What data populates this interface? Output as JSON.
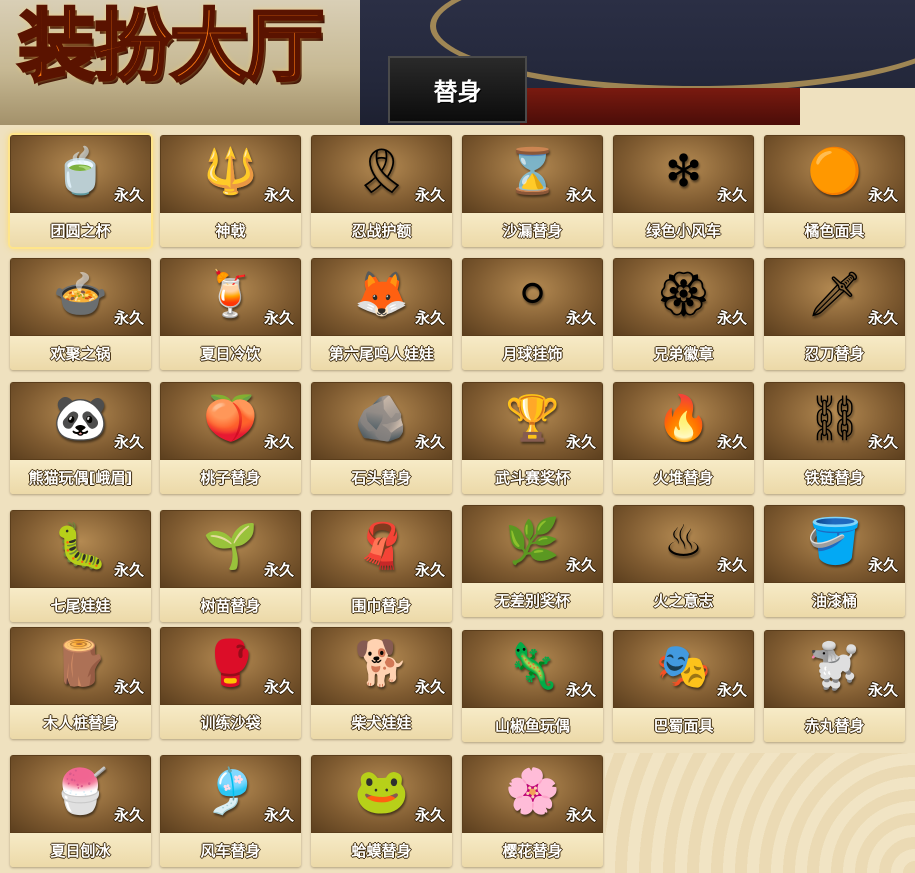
{
  "header": {
    "title": "装扮大厅",
    "tab_label": "替身"
  },
  "colors": {
    "title_orange": "#ff7a10",
    "card_brown": "#7e5a30",
    "label_cream": "#f0dfb4",
    "selected_glow": "#ffe58a"
  },
  "items": [
    {
      "name": "团圆之杯",
      "duration": "永久",
      "icon": "cup-icon",
      "glyph": "🍵",
      "selected": true
    },
    {
      "name": "神戟",
      "duration": "永久",
      "icon": "halberd-icon",
      "glyph": "🔱"
    },
    {
      "name": "忍战护额",
      "duration": "永久",
      "icon": "headband-icon",
      "glyph": "🎗"
    },
    {
      "name": "沙漏替身",
      "duration": "永久",
      "icon": "hourglass-icon",
      "glyph": "⌛"
    },
    {
      "name": "绿色小风车",
      "duration": "永久",
      "icon": "pinwheel-icon",
      "glyph": "❇"
    },
    {
      "name": "橘色面具",
      "duration": "永久",
      "icon": "mask-icon",
      "glyph": "🟠"
    },
    {
      "name": "欢聚之锅",
      "duration": "永久",
      "icon": "pot-icon",
      "glyph": "🍲"
    },
    {
      "name": "夏日冷饮",
      "duration": "永久",
      "icon": "cold-drink-icon",
      "glyph": "🍹"
    },
    {
      "name": "第六尾鸣人娃娃",
      "duration": "永久",
      "icon": "doll-icon",
      "glyph": "🦊"
    },
    {
      "name": "月球挂饰",
      "duration": "永久",
      "icon": "moon-charm-icon",
      "glyph": "⚪"
    },
    {
      "name": "兄弟徽章",
      "duration": "永久",
      "icon": "badge-icon",
      "glyph": "🏵"
    },
    {
      "name": "忍刀替身",
      "duration": "永久",
      "icon": "ninja-sword-icon",
      "glyph": "🗡"
    },
    {
      "name": "熊猫玩偶[峨眉]",
      "duration": "永久",
      "icon": "panda-icon",
      "glyph": "🐼"
    },
    {
      "name": "桃子替身",
      "duration": "永久",
      "icon": "peach-icon",
      "glyph": "🍑"
    },
    {
      "name": "石头替身",
      "duration": "永久",
      "icon": "stone-icon",
      "glyph": "🪨"
    },
    {
      "name": "武斗赛奖杯",
      "duration": "永久",
      "icon": "trophy-icon",
      "glyph": "🏆"
    },
    {
      "name": "火堆替身",
      "duration": "永久",
      "icon": "campfire-icon",
      "glyph": "🔥"
    },
    {
      "name": "铁链替身",
      "duration": "永久",
      "icon": "chain-icon",
      "glyph": "⛓"
    },
    {
      "name": "七尾娃娃",
      "duration": "永久",
      "icon": "larva-doll-icon",
      "glyph": "🐛"
    },
    {
      "name": "树苗替身",
      "duration": "永久",
      "icon": "sapling-icon",
      "glyph": "🌱"
    },
    {
      "name": "围巾替身",
      "duration": "永久",
      "icon": "scarf-icon",
      "glyph": "🧣"
    },
    {
      "name": "无差别奖杯",
      "duration": "永久",
      "icon": "branch-trophy-icon",
      "glyph": "🌿"
    },
    {
      "name": "火之意志",
      "duration": "永久",
      "icon": "will-of-fire-icon",
      "glyph": "♨"
    },
    {
      "name": "油漆桶",
      "duration": "永久",
      "icon": "paint-bucket-icon",
      "glyph": "🪣"
    },
    {
      "name": "木人桩替身",
      "duration": "永久",
      "icon": "wooden-dummy-icon",
      "glyph": "🪵"
    },
    {
      "name": "训练沙袋",
      "duration": "永久",
      "icon": "sandbag-icon",
      "glyph": "🥊"
    },
    {
      "name": "柴犬娃娃",
      "duration": "永久",
      "icon": "shiba-doll-icon",
      "glyph": "🐕"
    },
    {
      "name": "山椒鱼玩偶",
      "duration": "永久",
      "icon": "salamander-doll-icon",
      "glyph": "🦎"
    },
    {
      "name": "巴蜀面具",
      "duration": "永久",
      "icon": "opera-mask-icon",
      "glyph": "🎭"
    },
    {
      "name": "赤丸替身",
      "duration": "永久",
      "icon": "dog-plush-icon",
      "glyph": "🐩"
    },
    {
      "name": "夏日刨冰",
      "duration": "永久",
      "icon": "shaved-ice-icon",
      "glyph": "🍧"
    },
    {
      "name": "风车替身",
      "duration": "永久",
      "icon": "pinwheel-red-icon",
      "glyph": "🎐"
    },
    {
      "name": "蛤蟆替身",
      "duration": "永久",
      "icon": "toad-icon",
      "glyph": "🐸"
    },
    {
      "name": "樱花替身",
      "duration": "永久",
      "icon": "sakura-icon",
      "glyph": "🌸"
    }
  ]
}
